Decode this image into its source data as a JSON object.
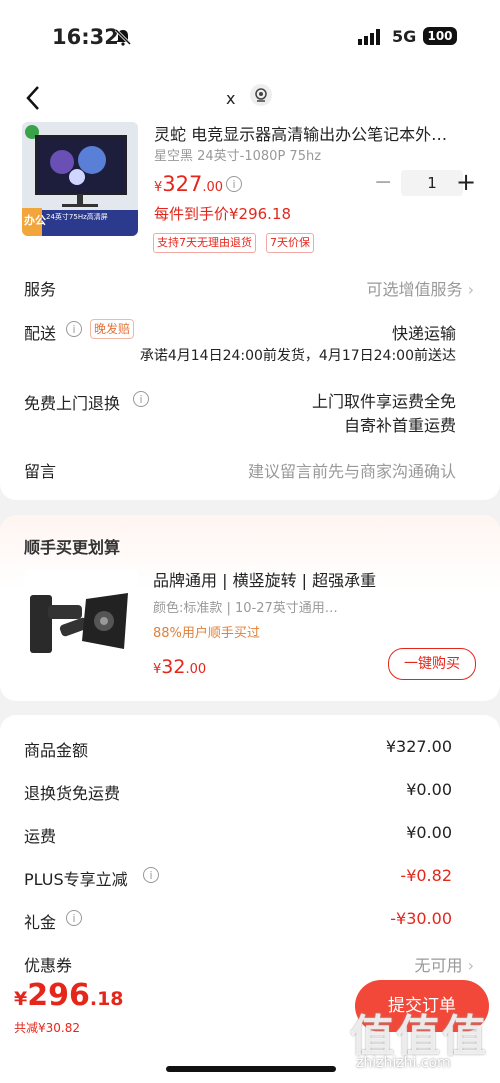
{
  "status_bar": {
    "time": "16:32",
    "network": "5G",
    "battery": "100"
  },
  "header": {
    "close_label": "x"
  },
  "product": {
    "title": "灵蛇 电竞显示器高清输出办公笔记本外…",
    "spec": "星空黑 24英寸-1080P 75hz",
    "price_symbol": "¥",
    "price_int": "327",
    "price_dec": ".00",
    "quantity": "1",
    "promo_price": "每件到手价¥296.18",
    "tags": [
      "支持7天无理由退货",
      "7天价保"
    ],
    "thumb_badges": [
      "办公",
      "24英寸75Hz高清屏"
    ]
  },
  "rows": {
    "service_label": "服务",
    "service_value": "可选增值服务",
    "delivery_label": "配送",
    "delivery_badge": "晚发赔",
    "delivery_method": "快递运输",
    "delivery_promise": "承诺4月14日24:00前发货，4月17日24:00前送达",
    "return_label": "免费上门退换",
    "return_line1": "上门取件享运费全免",
    "return_line2": "自寄补首重运费",
    "message_label": "留言",
    "message_placeholder": "建议留言前先与商家沟通确认"
  },
  "addon": {
    "section_title": "顺手买更划算",
    "title": "品牌通用 | 横竖旋转 | 超强承重",
    "spec": "颜色:标准款 | 10-27英寸通用…",
    "buyers": "88%用户顺手买过",
    "price_symbol": "¥",
    "price_int": "32",
    "price_dec": ".00",
    "buy_button": "一键购买"
  },
  "summary": {
    "goods_label": "商品金额",
    "goods_value": "¥327.00",
    "return_fee_label": "退换货免运费",
    "return_fee_value": "¥0.00",
    "shipping_label": "运费",
    "shipping_value": "¥0.00",
    "plus_label": "PLUS专享立减",
    "plus_value": "-¥0.82",
    "gift_label": "礼金",
    "gift_value": "-¥30.00",
    "coupon_label": "优惠券",
    "coupon_value": "无可用"
  },
  "footer": {
    "total_symbol": "¥",
    "total_int": "296",
    "total_dec": ".18",
    "saved": "共减¥30.82",
    "submit_label": "提交订单"
  },
  "watermark": {
    "text": "值值值",
    "domain": "zhizhizhi.com"
  },
  "colors": {
    "accent": "#e5261b",
    "orange": "#e0803a",
    "submit": "#f2483a"
  }
}
